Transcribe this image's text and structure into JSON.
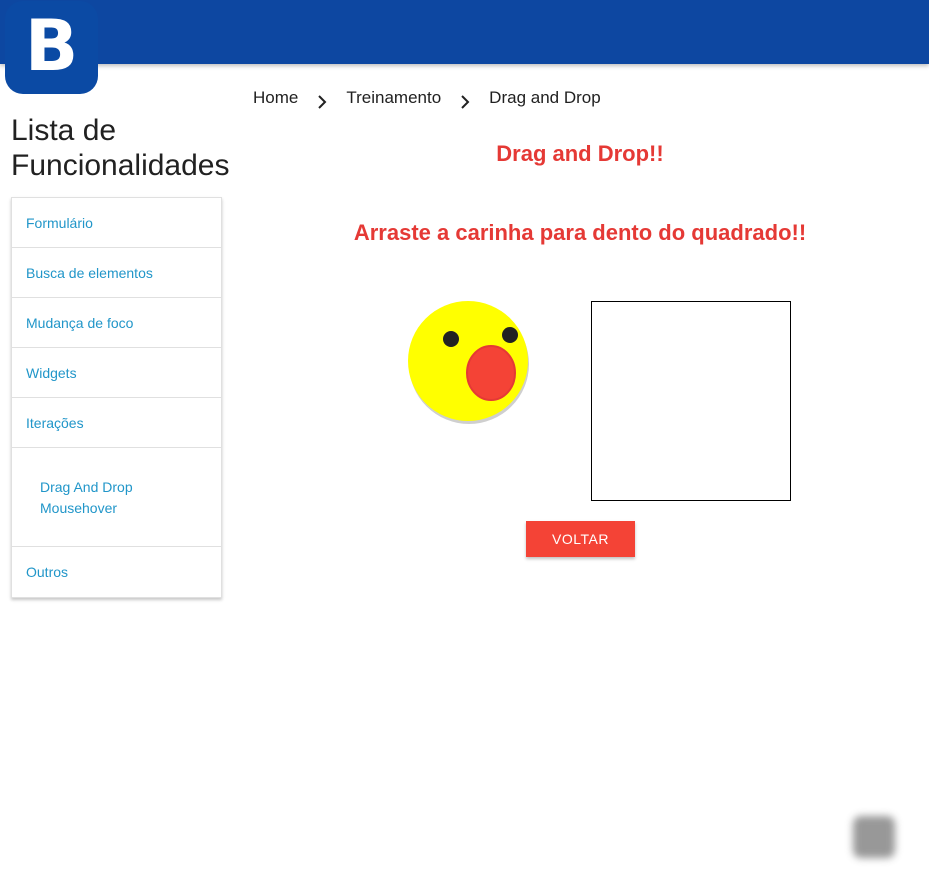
{
  "header": {
    "logo_letter": "B",
    "bar_color": "#0d47a1"
  },
  "breadcrumb": {
    "items": [
      "Home",
      "Treinamento",
      "Drag and Drop"
    ]
  },
  "sidebar": {
    "title": "Lista de Funcionalidades",
    "items": [
      {
        "label": "Formulário"
      },
      {
        "label": "Busca de elementos"
      },
      {
        "label": "Mudança de foco"
      },
      {
        "label": "Widgets"
      },
      {
        "label": "Iterações"
      }
    ],
    "sub_items": [
      {
        "label": "Drag And Drop"
      },
      {
        "label": "Mousehover"
      }
    ],
    "last_item": {
      "label": "Outros"
    },
    "link_color": "#2196c9"
  },
  "main": {
    "heading": "Drag and Drop!!",
    "instructions": "Arraste a carinha para dento do quadrado!!",
    "back_button": "VOLTAR",
    "accent_color": "#e53935"
  },
  "icons": {
    "draggable": "surprised-face-icon",
    "separator": "chevron-right-icon",
    "fab": "floating-action-button"
  }
}
